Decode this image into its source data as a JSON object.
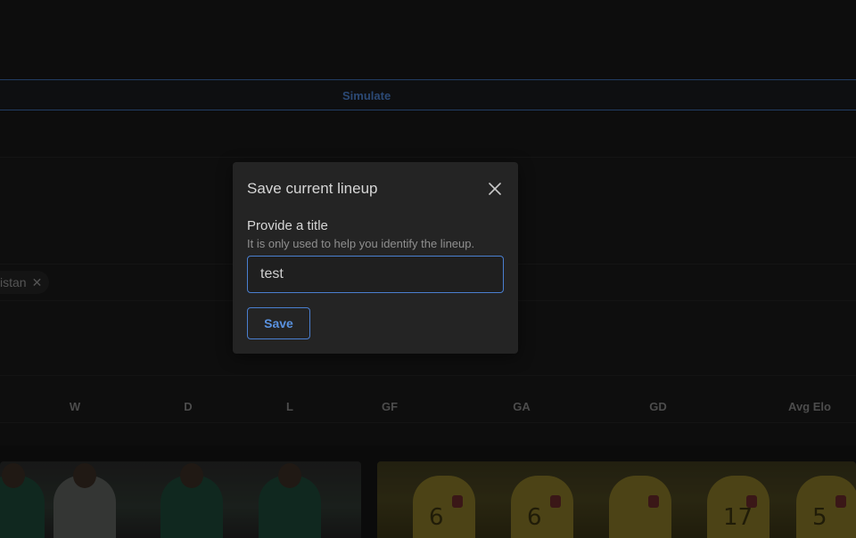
{
  "simulate_bar": {
    "label": "Simulate"
  },
  "filters": {
    "chips": [
      {
        "label": "istan",
        "remove_glyph": "✕"
      }
    ]
  },
  "results_table": {
    "columns": [
      "W",
      "D",
      "L",
      "GF",
      "GA",
      "GD",
      "Avg Elo"
    ]
  },
  "team_photos": [
    {
      "kit": "white-green",
      "icon": "team-photo"
    },
    {
      "kit": "yellow",
      "numbers": [
        "6",
        "6",
        "17",
        "5"
      ],
      "icon": "team-photo"
    }
  ],
  "modal": {
    "title": "Save current lineup",
    "close_icon": "close-icon",
    "field_label": "Provide a title",
    "field_description": "It is only used to help you identify the lineup.",
    "input_value": "test",
    "save_label": "Save"
  },
  "colors": {
    "accent": "#4a7fd0",
    "background": "#141414",
    "modal_background": "#242424"
  }
}
